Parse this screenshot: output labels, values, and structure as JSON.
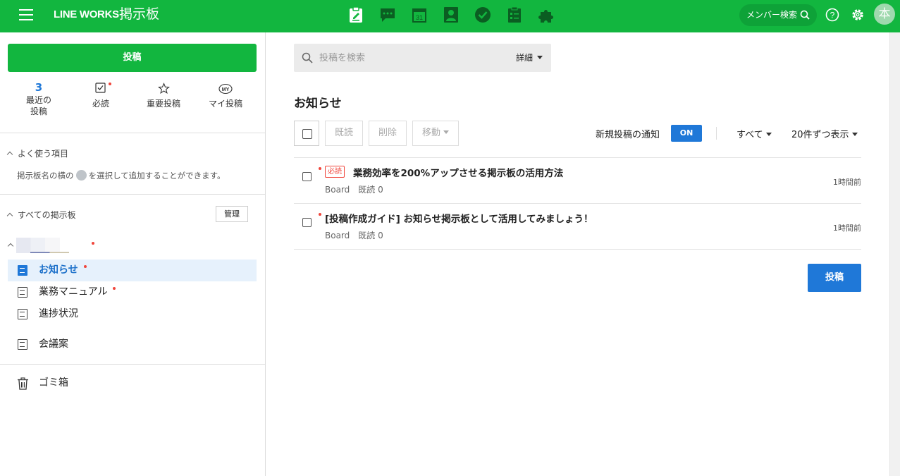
{
  "header": {
    "brand": "LINE WORKS",
    "app_name": "掲示板",
    "member_search": "メンバー検索",
    "avatar_text": "本",
    "apps": [
      "board-icon",
      "chat-icon",
      "calendar-icon",
      "contacts-icon",
      "task-icon",
      "form-icon",
      "addon-icon"
    ],
    "calendar_day": "31",
    "brand_color": "#12b63f"
  },
  "sidebar": {
    "post_button": "投稿",
    "quick": [
      {
        "count": "3",
        "label_line1": "最近の",
        "label_line2": "投稿"
      },
      {
        "label": "必読"
      },
      {
        "label": "重要投稿"
      },
      {
        "label": "マイ投稿",
        "badge": "MY"
      }
    ],
    "favorites_head": "よく使う項目",
    "favorites_hint_before": "掲示板名の横の",
    "favorites_hint_after": "を選択して追加することができます。",
    "all_boards_head": "すべての掲示板",
    "manage": "管理",
    "boards": [
      {
        "label": "お知らせ",
        "unread": true,
        "active": true
      },
      {
        "label": "業務マニュアル",
        "unread": true,
        "active": false
      },
      {
        "label": "進捗状況",
        "unread": false,
        "active": false
      },
      {
        "label": "会議案",
        "unread": false,
        "active": false
      }
    ],
    "trash": "ゴミ箱"
  },
  "main": {
    "search_placeholder": "投稿を検索",
    "search_detail": "詳細",
    "title": "お知らせ",
    "toolbar": {
      "read": "既読",
      "delete": "削除",
      "move": "移動"
    },
    "notify_label": "新規投稿の通知",
    "notify_state": "ON",
    "filter_all": "すべて",
    "page_size": "20件ずつ表示",
    "posts": [
      {
        "badge": "必読",
        "title": "業務効率を200%アップさせる掲示板の活用方法",
        "board": "Board",
        "reads": "既読 0",
        "time": "1時間前"
      },
      {
        "badge": "",
        "title": "[投稿作成ガイド] お知らせ掲示板として活用してみましょう！",
        "board": "Board",
        "reads": "既読 0",
        "time": "1時間前"
      }
    ],
    "post_button": "投稿",
    "accent": "#1f78d8"
  }
}
